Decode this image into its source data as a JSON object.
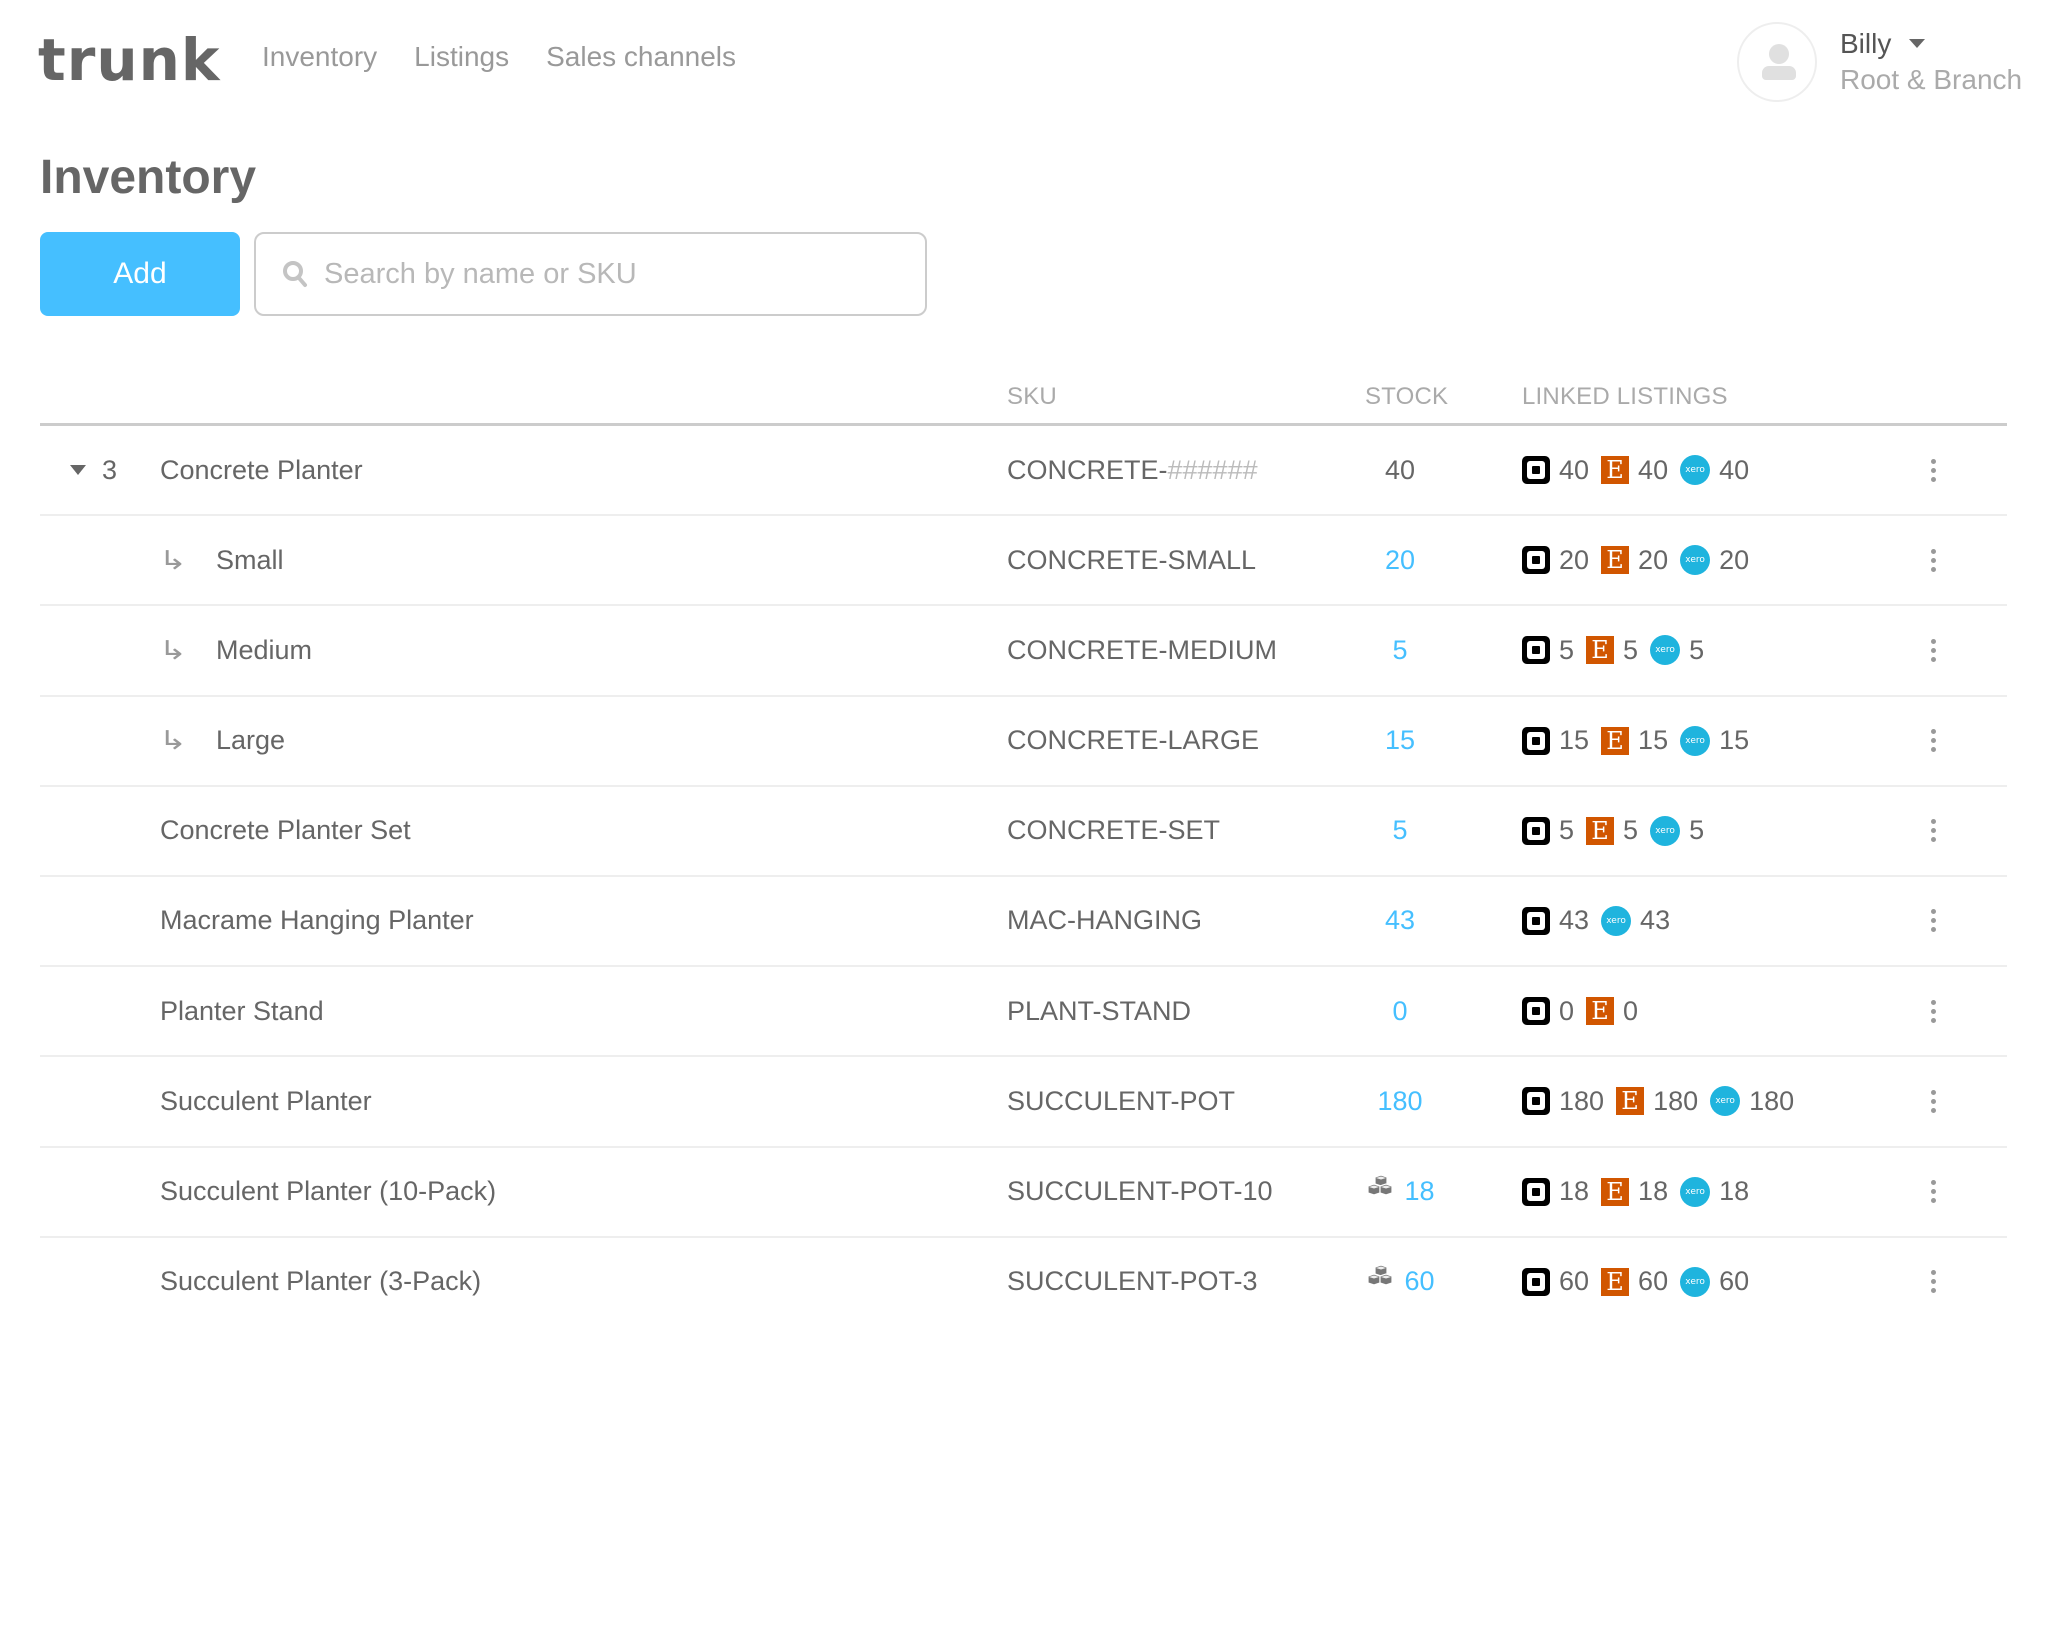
{
  "header": {
    "logo": "trunk",
    "nav": [
      {
        "label": "Inventory"
      },
      {
        "label": "Listings"
      },
      {
        "label": "Sales channels"
      }
    ],
    "user": {
      "name": "Billy",
      "organization": "Root & Branch",
      "avatar_icon": "user-silhouette-icon"
    }
  },
  "page": {
    "title": "Inventory",
    "add_label": "Add",
    "search_placeholder": "Search by name or SKU",
    "search_value": ""
  },
  "colors": {
    "accent": "#45bfff",
    "square": "#000000",
    "etsy": "#d15600",
    "xero": "#1fb4de"
  },
  "channel_icons": {
    "square": {
      "glyph": "",
      "icon": "square-pos-icon"
    },
    "etsy": {
      "glyph": "E",
      "icon": "etsy-icon"
    },
    "xero": {
      "glyph": "xero",
      "icon": "xero-icon"
    }
  },
  "table": {
    "columns": {
      "name": "",
      "sku": "SKU",
      "stock": "STOCK",
      "listings": "LINKED LISTINGS"
    },
    "rows": [
      {
        "type": "parent",
        "expanded": true,
        "variant_count": "3",
        "name": "Concrete Planter",
        "sku_prefix": "CONCRETE-",
        "sku_mask": "######",
        "stock": "40",
        "stock_link": false,
        "bundle": false,
        "listings": [
          {
            "channel": "square",
            "qty": "40"
          },
          {
            "channel": "etsy",
            "qty": "40"
          },
          {
            "channel": "xero",
            "qty": "40"
          }
        ]
      },
      {
        "type": "child",
        "name": "Small",
        "sku": "CONCRETE-SMALL",
        "stock": "20",
        "stock_link": true,
        "bundle": false,
        "listings": [
          {
            "channel": "square",
            "qty": "20"
          },
          {
            "channel": "etsy",
            "qty": "20"
          },
          {
            "channel": "xero",
            "qty": "20"
          }
        ]
      },
      {
        "type": "child",
        "name": "Medium",
        "sku": "CONCRETE-MEDIUM",
        "stock": "5",
        "stock_link": true,
        "bundle": false,
        "listings": [
          {
            "channel": "square",
            "qty": "5"
          },
          {
            "channel": "etsy",
            "qty": "5"
          },
          {
            "channel": "xero",
            "qty": "5"
          }
        ]
      },
      {
        "type": "child",
        "name": "Large",
        "sku": "CONCRETE-LARGE",
        "stock": "15",
        "stock_link": true,
        "bundle": false,
        "listings": [
          {
            "channel": "square",
            "qty": "15"
          },
          {
            "channel": "etsy",
            "qty": "15"
          },
          {
            "channel": "xero",
            "qty": "15"
          }
        ]
      },
      {
        "type": "item",
        "name": "Concrete Planter Set",
        "sku": "CONCRETE-SET",
        "stock": "5",
        "stock_link": true,
        "bundle": false,
        "listings": [
          {
            "channel": "square",
            "qty": "5"
          },
          {
            "channel": "etsy",
            "qty": "5"
          },
          {
            "channel": "xero",
            "qty": "5"
          }
        ]
      },
      {
        "type": "item",
        "name": "Macrame Hanging Planter",
        "sku": "MAC-HANGING",
        "stock": "43",
        "stock_link": true,
        "bundle": false,
        "listings": [
          {
            "channel": "square",
            "qty": "43"
          },
          {
            "channel": "xero",
            "qty": "43"
          }
        ]
      },
      {
        "type": "item",
        "name": "Planter Stand",
        "sku": "PLANT-STAND",
        "stock": "0",
        "stock_link": true,
        "bundle": false,
        "listings": [
          {
            "channel": "square",
            "qty": "0"
          },
          {
            "channel": "etsy",
            "qty": "0"
          }
        ]
      },
      {
        "type": "item",
        "name": "Succulent Planter",
        "sku": "SUCCULENT-POT",
        "stock": "180",
        "stock_link": true,
        "bundle": false,
        "listings": [
          {
            "channel": "square",
            "qty": "180"
          },
          {
            "channel": "etsy",
            "qty": "180"
          },
          {
            "channel": "xero",
            "qty": "180"
          }
        ]
      },
      {
        "type": "item",
        "name": "Succulent Planter (10-Pack)",
        "sku": "SUCCULENT-POT-10",
        "stock": "18",
        "stock_link": true,
        "bundle": true,
        "listings": [
          {
            "channel": "square",
            "qty": "18"
          },
          {
            "channel": "etsy",
            "qty": "18"
          },
          {
            "channel": "xero",
            "qty": "18"
          }
        ]
      },
      {
        "type": "item",
        "name": "Succulent Planter (3-Pack)",
        "sku": "SUCCULENT-POT-3",
        "stock": "60",
        "stock_link": true,
        "bundle": true,
        "listings": [
          {
            "channel": "square",
            "qty": "60"
          },
          {
            "channel": "etsy",
            "qty": "60"
          },
          {
            "channel": "xero",
            "qty": "60"
          }
        ]
      }
    ]
  }
}
